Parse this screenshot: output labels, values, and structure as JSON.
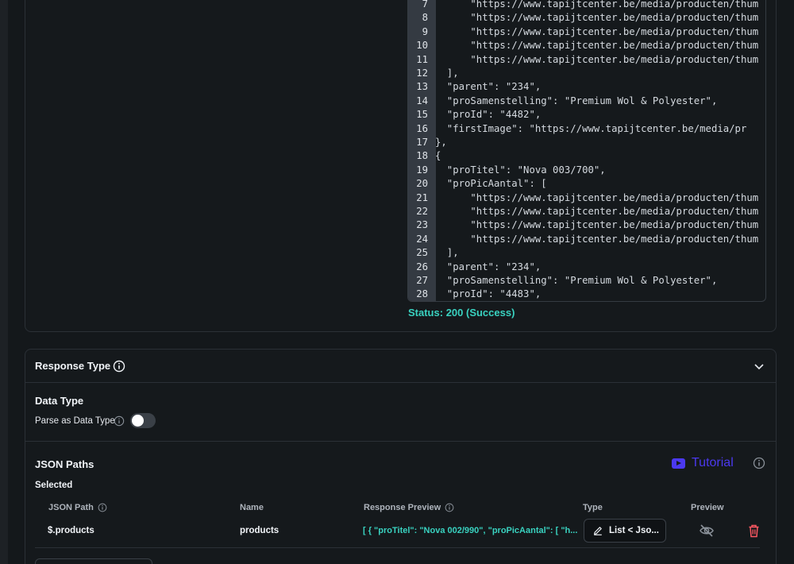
{
  "code": {
    "lines": [
      {
        "n": "7",
        "text": "  \"https://www.tapijtcenter.be/media/producten/thum"
      },
      {
        "n": "8",
        "text": "  \"https://www.tapijtcenter.be/media/producten/thum"
      },
      {
        "n": "9",
        "text": "  \"https://www.tapijtcenter.be/media/producten/thum"
      },
      {
        "n": "10",
        "text": "  \"https://www.tapijtcenter.be/media/producten/thum"
      },
      {
        "n": "11",
        "text": "  \"https://www.tapijtcenter.be/media/producten/thum"
      },
      {
        "n": "12",
        "text": "],"
      },
      {
        "n": "13",
        "text": "\"parent\": \"234\","
      },
      {
        "n": "14",
        "text": "\"proSamenstelling\": \"Premium Wol & Polyester\","
      },
      {
        "n": "15",
        "text": "\"proId\": \"4482\","
      },
      {
        "n": "16",
        "text": "\"firstImage\": \"https://www.tapijtcenter.be/media/pr"
      },
      {
        "n": "17",
        "text": "},"
      },
      {
        "n": "18",
        "text": "{"
      },
      {
        "n": "19",
        "text": "\"proTitel\": \"Nova 003/700\","
      },
      {
        "n": "20",
        "text": "\"proPicAantal\": ["
      },
      {
        "n": "21",
        "text": "  \"https://www.tapijtcenter.be/media/producten/thum"
      },
      {
        "n": "22",
        "text": "  \"https://www.tapijtcenter.be/media/producten/thum"
      },
      {
        "n": "23",
        "text": "  \"https://www.tapijtcenter.be/media/producten/thum"
      },
      {
        "n": "24",
        "text": "  \"https://www.tapijtcenter.be/media/producten/thum"
      },
      {
        "n": "25",
        "text": "],"
      },
      {
        "n": "26",
        "text": "\"parent\": \"234\","
      },
      {
        "n": "27",
        "text": "\"proSamenstelling\": \"Premium Wol & Polyester\","
      },
      {
        "n": "28",
        "text": "\"proId\": \"4483\","
      }
    ]
  },
  "status": {
    "label": "Status:",
    "value": "200 (Success)"
  },
  "response_type": {
    "title": "Response Type"
  },
  "data_type": {
    "title": "Data Type",
    "parse_label": "Parse as Data Type",
    "parse_enabled": false
  },
  "json_paths": {
    "title": "JSON Paths",
    "tutorial_label": "Tutorial",
    "selected_label": "Selected",
    "columns": {
      "json_path": "JSON Path",
      "name": "Name",
      "response_preview": "Response Preview",
      "type": "Type",
      "preview": "Preview"
    },
    "rows": [
      {
        "json_path": "$.products",
        "name": "products",
        "response_preview": "[ {  \"proTitel\": \"Nova 002/990\",  \"proPicAantal\": [   \"h...",
        "type": "List < Jso..."
      }
    ]
  },
  "colors": {
    "accent": "#4b39ef",
    "success": "#39d2c0",
    "danger": "#ff5963",
    "background": "#14181b"
  }
}
